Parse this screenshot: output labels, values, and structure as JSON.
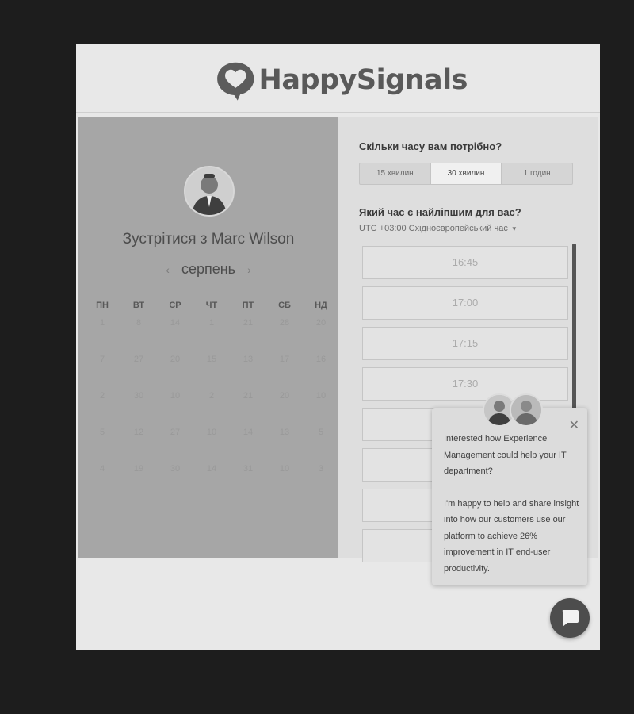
{
  "brand": {
    "name": "HappySignals"
  },
  "scheduler": {
    "title": "Зустрітися з Marc Wilson",
    "month": "серпень",
    "weekdays": [
      "ПН",
      "ВТ",
      "СР",
      "ЧТ",
      "ПТ",
      "СБ",
      "НД"
    ],
    "days": [
      [
        "1",
        "8",
        "14",
        "1",
        "21",
        "28",
        "20"
      ],
      [
        "7",
        "27",
        "20",
        "15",
        "13",
        "17",
        "16"
      ],
      [
        "2",
        "30",
        "10",
        "2",
        "21",
        "20",
        "10"
      ],
      [
        "5",
        "12",
        "27",
        "10",
        "14",
        "13",
        "5"
      ],
      [
        "4",
        "19",
        "30",
        "14",
        "31",
        "10",
        "3"
      ]
    ]
  },
  "duration": {
    "question": "Скільки часу вам потрібно?",
    "options": [
      "15 хвилин",
      "30 хвилин",
      "1 годин"
    ],
    "selected": "30 хвилин"
  },
  "time": {
    "question": "Який час є найліпшим для вас?",
    "timezone": "UTC +03:00 Східноєвропейський час",
    "slots": [
      "16:45",
      "17:00",
      "17:15",
      "17:30",
      "",
      "",
      "",
      ""
    ]
  },
  "chat": {
    "message_1": "Interested how Experience Management could help your IT department?",
    "message_2": "I'm happy to help and share insight into how our customers use our platform to achieve 26% improvement in IT end-user productivity.",
    "close_icon": "close-icon",
    "launcher_icon": "chat-bubble-icon"
  }
}
